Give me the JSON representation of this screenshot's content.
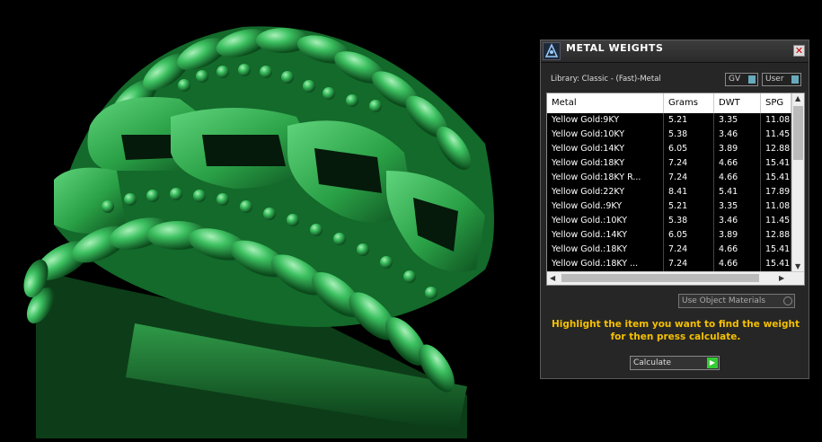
{
  "colors": {
    "ring": "#2fa84d",
    "highlight": "#f5c000",
    "row_bg": "#000000"
  },
  "panel": {
    "title": "METAL WEIGHTS",
    "close_icon": "close-icon",
    "library": "Library: Classic - (Fast)-Metal",
    "units": [
      {
        "label": "GV",
        "icon": "toggle-indicator"
      },
      {
        "label": "User",
        "icon": "toggle-indicator"
      }
    ],
    "columns": [
      "Metal",
      "Grams",
      "DWT",
      "SPG"
    ],
    "rows": [
      [
        "Yellow Gold:9KY",
        "5.21",
        "3.35",
        "11.08"
      ],
      [
        "Yellow Gold:10KY",
        "5.38",
        "3.46",
        "11.45"
      ],
      [
        "Yellow Gold:14KY",
        "6.05",
        "3.89",
        "12.88"
      ],
      [
        "Yellow Gold:18KY",
        "7.24",
        "4.66",
        "15.41"
      ],
      [
        "Yellow Gold:18KY R...",
        "7.24",
        "4.66",
        "15.41"
      ],
      [
        "Yellow Gold:22KY",
        "8.41",
        "5.41",
        "17.89"
      ],
      [
        "Yellow Gold.:9KY",
        "5.21",
        "3.35",
        "11.08"
      ],
      [
        "Yellow Gold.:10KY",
        "5.38",
        "3.46",
        "11.45"
      ],
      [
        "Yellow Gold.:14KY",
        "6.05",
        "3.89",
        "12.88"
      ],
      [
        "Yellow Gold.:18KY",
        "7.24",
        "4.66",
        "15.41"
      ],
      [
        "Yellow Gold.:18KY ...",
        "7.24",
        "4.66",
        "15.41"
      ]
    ],
    "use_object_materials": "Use Object Materials",
    "hint": "Highlight the item you want to find the weight for then press calculate.",
    "calculate": "Calculate"
  }
}
